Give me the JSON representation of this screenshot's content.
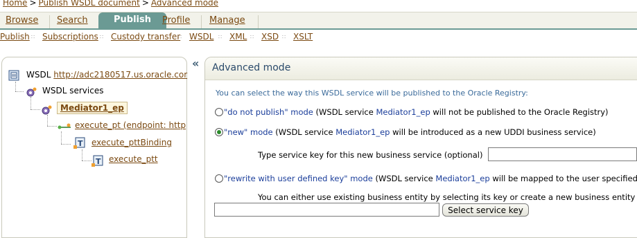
{
  "breadcrumb": {
    "home": "Home",
    "sep": ">",
    "publish_wsdl": "Publish WSDL document",
    "current": "Advanced mode"
  },
  "tabs": {
    "browse": "Browse",
    "search": "Search",
    "publish": "Publish",
    "profile": "Profile",
    "manage": "Manage"
  },
  "subnav": {
    "publish": "Publish",
    "subscriptions": "Subscriptions",
    "custody": "Custody transfer",
    "wsdl": "WSDL",
    "xml": "XML",
    "xsd": "XSD",
    "xslt": "XSLT",
    "separator": "∷"
  },
  "tree": {
    "root_label": "WSDL",
    "root_link": "http://adc2180517.us.oracle.cor",
    "services": "WSDL services",
    "mediator": "Mediator1_ep",
    "execute_pt": "execute_pt (endpoint: http",
    "binding": "execute_pttBinding",
    "ptt": "execute_ptt"
  },
  "collapse_glyph": "«",
  "main": {
    "title": "Advanced mode",
    "intro": "You can select the way this WSDL service will be published to the Oracle Registry:",
    "opt1_mode": "\"do not publish\" mode",
    "opt1_pre": "(WSDL service",
    "opt1_svc": "Mediator1_ep",
    "opt1_post": "will not be published to the Oracle Registry)",
    "opt2_mode": "\"new\" mode",
    "opt2_pre": "(WSDL service",
    "opt2_svc": "Mediator1_ep",
    "opt2_post": "will be introduced as a new UDDI business service)",
    "opt2_key_label": "Type service key for this new business service (optional)",
    "opt3_mode": "\"rewrite with user defined key\" mode",
    "opt3_pre": "(WSDL service",
    "opt3_svc": "Mediator1_ep",
    "opt3_post": "will be mapped to the user specified",
    "opt3_help": "You can either use existing business entity by selecting its key or create a new business entity",
    "select_key_button": "Select service key",
    "selected_option": 2
  },
  "colors": {
    "tab_active": "#6b9a94",
    "link": "#7b4a12",
    "title": "#2a4a6b",
    "service_blue": "#1a3d9a"
  }
}
